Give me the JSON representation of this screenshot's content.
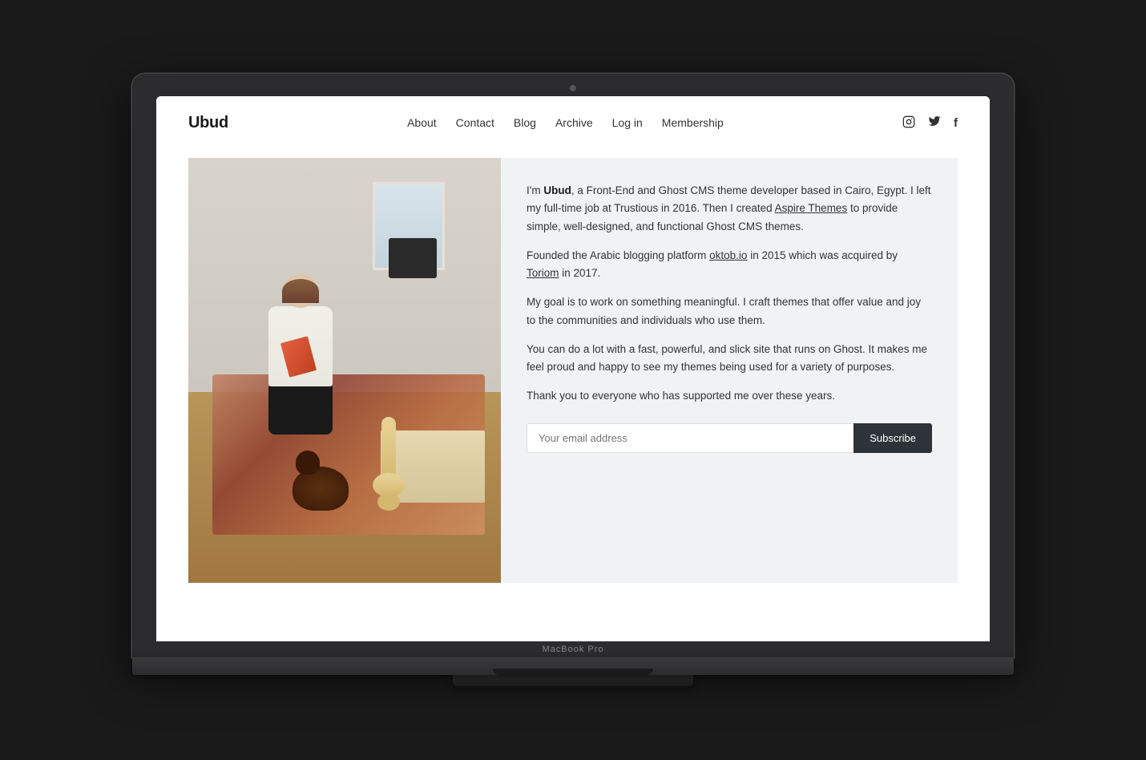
{
  "laptop": {
    "model_label": "MacBook Pro"
  },
  "site": {
    "logo": "Ubud",
    "nav": {
      "links": [
        {
          "label": "About",
          "href": "#"
        },
        {
          "label": "Contact",
          "href": "#"
        },
        {
          "label": "Blog",
          "href": "#"
        },
        {
          "label": "Archive",
          "href": "#"
        },
        {
          "label": "Log in",
          "href": "#"
        },
        {
          "label": "Membership",
          "href": "#"
        }
      ],
      "icons": [
        {
          "name": "instagram-icon",
          "symbol": "𝕀"
        },
        {
          "name": "twitter-icon",
          "symbol": "𝕏"
        },
        {
          "name": "facebook-icon",
          "symbol": "f"
        }
      ]
    },
    "bio": {
      "paragraph1_pre": "I'm ",
      "paragraph1_bold": "Ubud",
      "paragraph1_post": ", a Front-End and Ghost CMS theme developer based in Cairo, Egypt. I left my full-time job at Trustious in 2016. Then I created ",
      "paragraph1_link": "Aspire Themes",
      "paragraph1_end": " to provide simple, well-designed, and functional Ghost CMS themes.",
      "paragraph2_pre": "Founded the Arabic blogging platform ",
      "paragraph2_link1": "oktob.io",
      "paragraph2_mid": " in 2015 which was acquired by ",
      "paragraph2_link2": "Toriom",
      "paragraph2_end": " in 2017.",
      "paragraph3": "My goal is to work on something meaningful. I craft themes that offer value and joy to the communities and individuals who use them.",
      "paragraph4": "You can do a lot with a fast, powerful, and slick site that runs on Ghost. It makes me feel proud and happy to see my themes being used for a variety of purposes.",
      "paragraph5": "Thank you to everyone who has supported me over these years."
    },
    "subscribe": {
      "placeholder": "Your email address",
      "button_label": "Subscribe"
    }
  }
}
